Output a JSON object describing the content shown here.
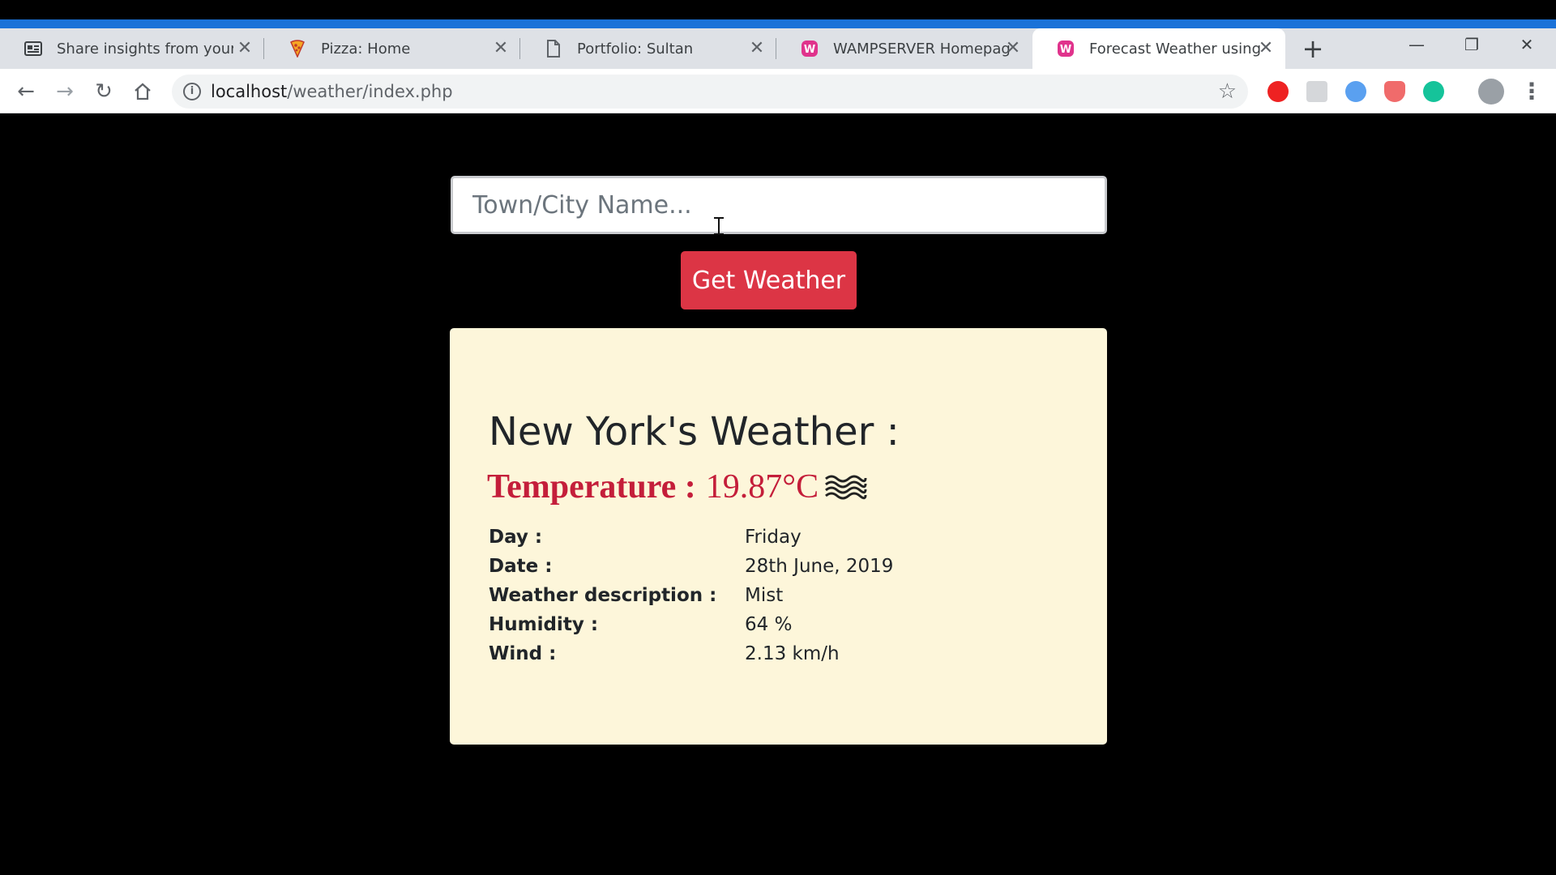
{
  "browser": {
    "tabs": [
      {
        "title": "Share insights from your de",
        "icon": "news-icon"
      },
      {
        "title": "Pizza: Home",
        "icon": "pizza-icon"
      },
      {
        "title": "Portfolio: Sultan",
        "icon": "page-icon"
      },
      {
        "title": "WAMPSERVER Homepage",
        "icon": "wamp-icon"
      },
      {
        "title": "Forecast Weather using Op",
        "icon": "wamp-icon",
        "active": true
      }
    ],
    "new_tab_label": "+",
    "address": {
      "host": "localhost",
      "path": "/weather/index.php"
    }
  },
  "search": {
    "placeholder": "Town/City Name...",
    "button_label": "Get Weather"
  },
  "weather": {
    "city_title": "New York's Weather :",
    "temperature_label": "Temperature :",
    "temperature_value": "19.87°C",
    "details": [
      {
        "key": "Day :",
        "value": "Friday"
      },
      {
        "key": "Date :",
        "value": "28th June, 2019"
      },
      {
        "key": "Weather description :",
        "value": "Mist"
      },
      {
        "key": "Humidity :",
        "value": "64 %"
      },
      {
        "key": "Wind :",
        "value": "2.13 km/h"
      }
    ]
  },
  "colors": {
    "accent_bar": "#1b72d8",
    "button_red": "#dc3545",
    "temperature_red": "#c41e3a",
    "card_bg": "#fdf6da"
  }
}
